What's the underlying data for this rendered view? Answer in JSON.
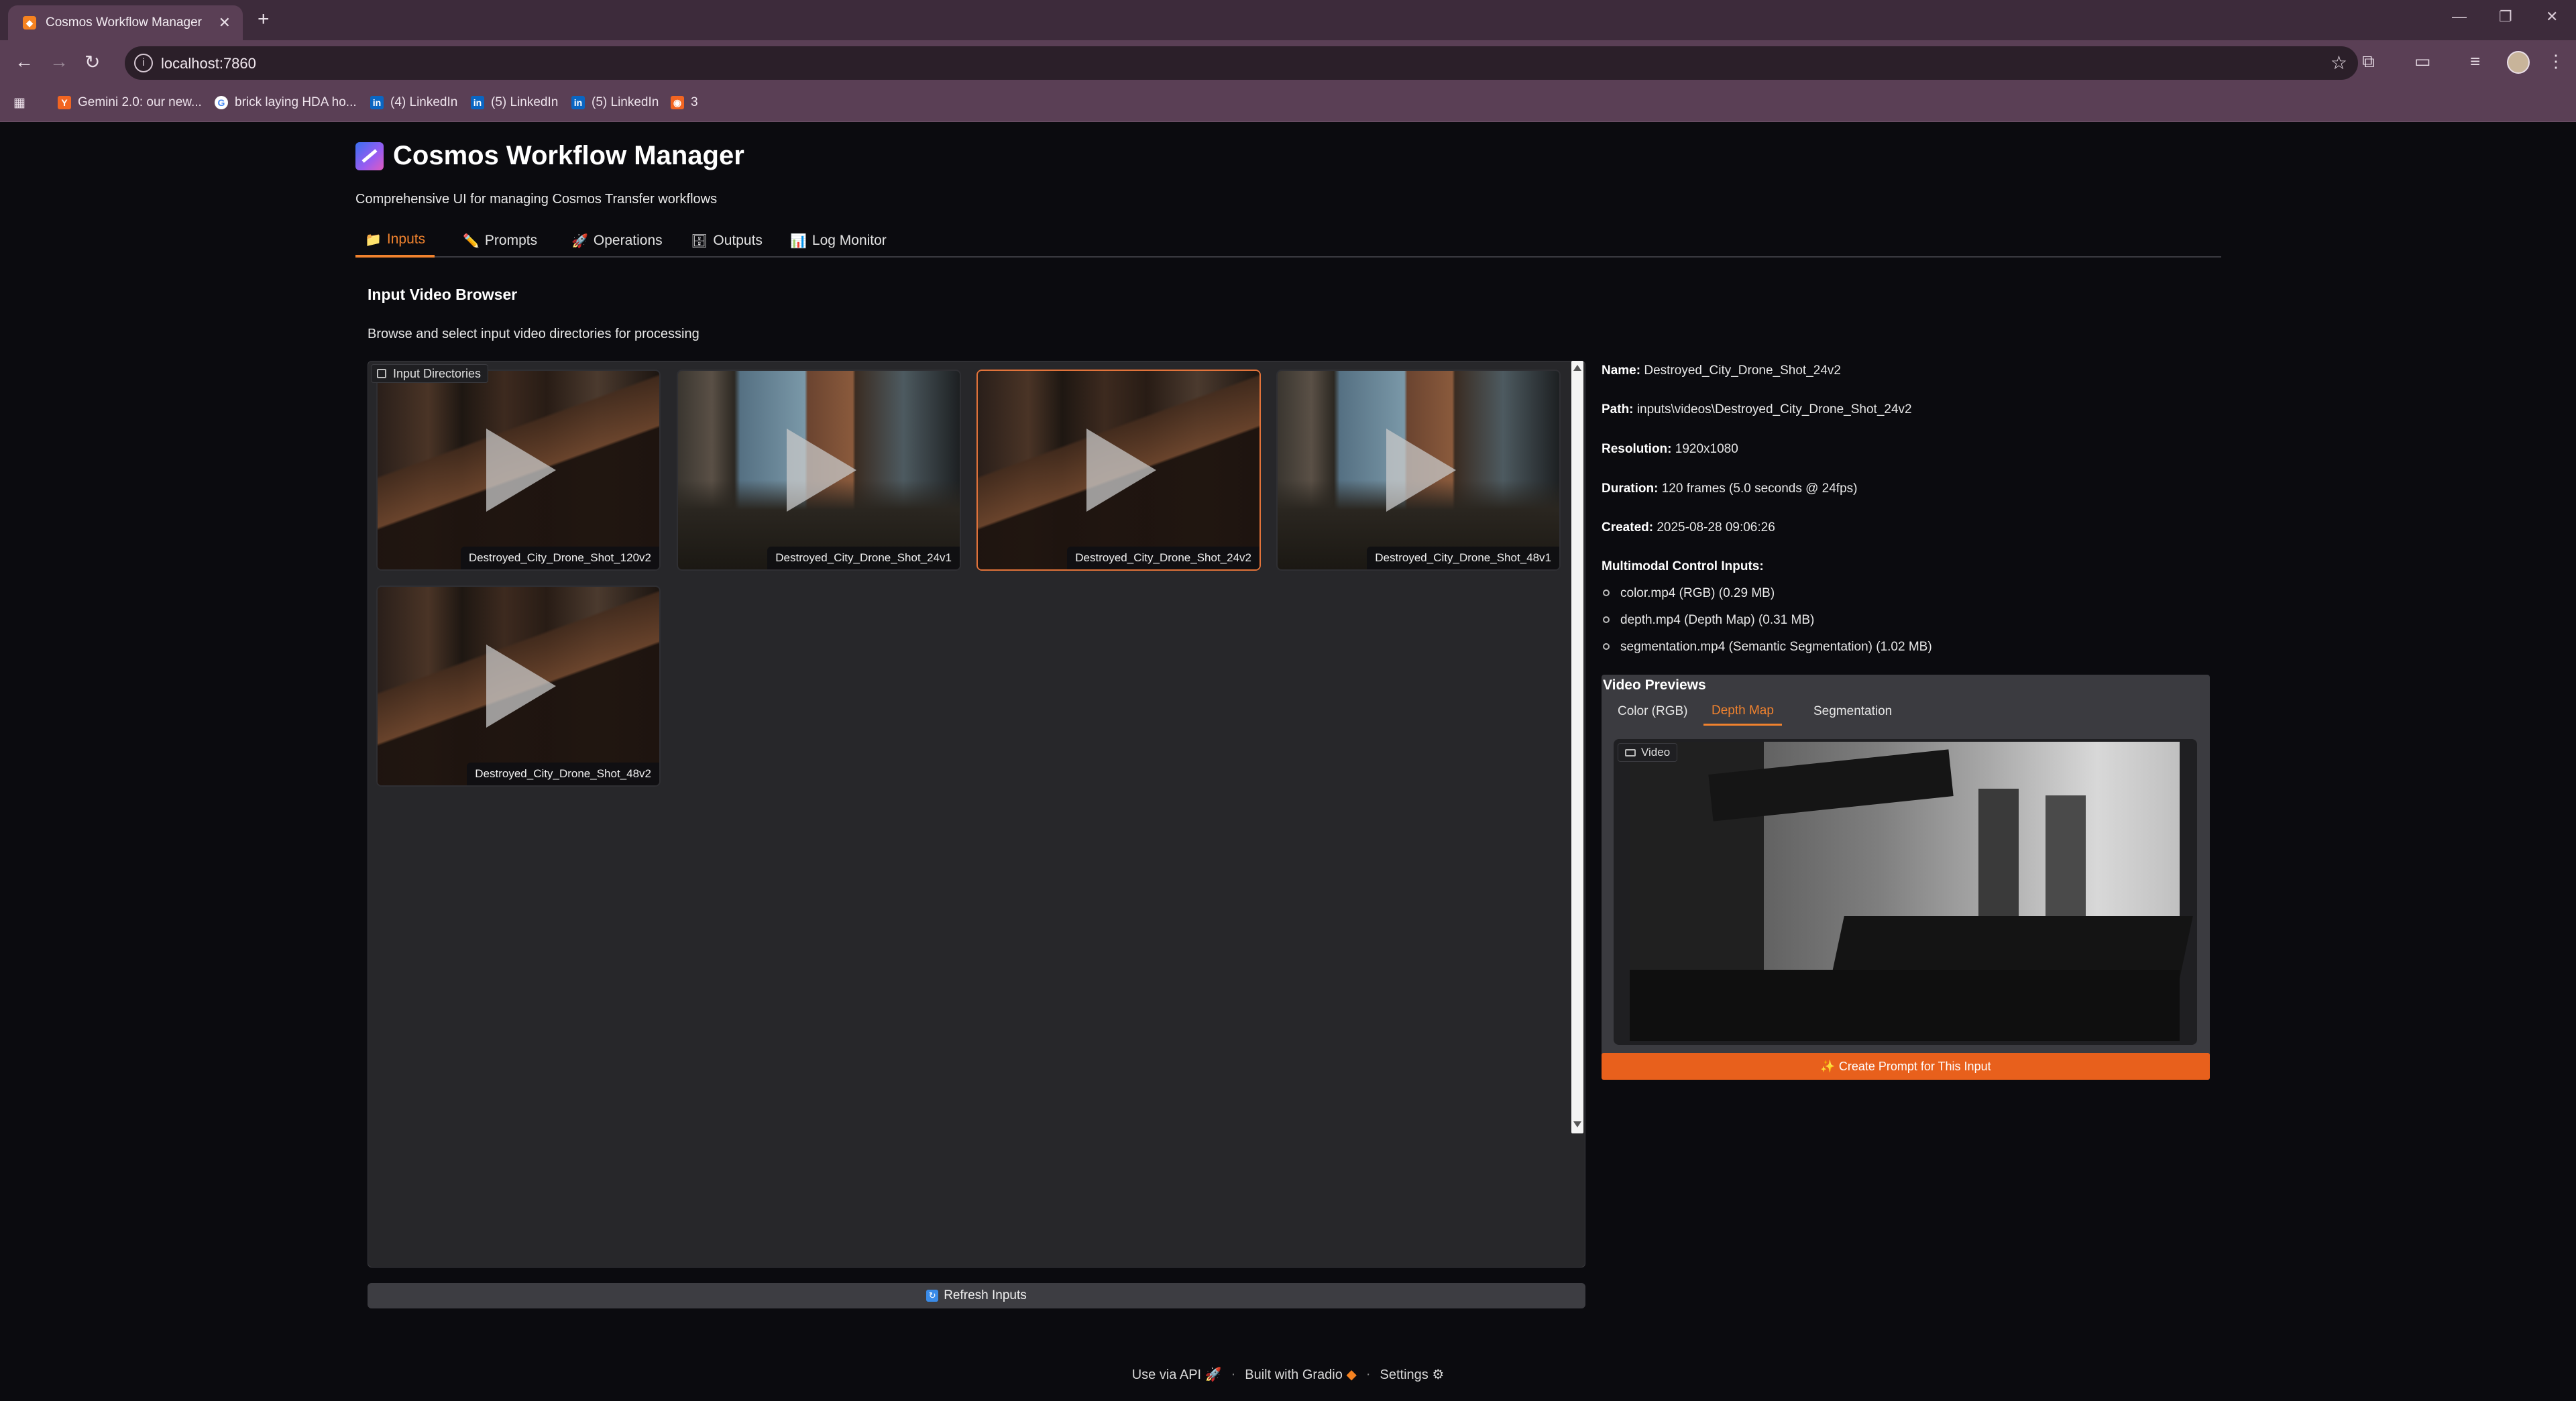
{
  "browser": {
    "tab_title": "Cosmos Workflow Manager",
    "url": "localhost:7860",
    "bookmarks": [
      {
        "label": "Gemini 2.0: our new...",
        "icon": "y-combinator-icon",
        "color": "#f26522"
      },
      {
        "label": "brick laying HDA ho...",
        "icon": "google-icon",
        "color": "#4285f4"
      },
      {
        "label": "(4) LinkedIn",
        "icon": "linkedin-icon",
        "color": "#0a66c2"
      },
      {
        "label": "(5) LinkedIn",
        "icon": "linkedin-icon",
        "color": "#0a66c2"
      },
      {
        "label": "(5) LinkedIn",
        "icon": "linkedin-icon",
        "color": "#0a66c2"
      },
      {
        "label": "3",
        "icon": "rss-icon",
        "color": "#f26522"
      }
    ]
  },
  "app": {
    "title": "Cosmos Workflow Manager",
    "subtitle": "Comprehensive UI for managing Cosmos Transfer workflows",
    "accent": "#f0822e"
  },
  "tabs": [
    {
      "label": "Inputs",
      "icon": "📁",
      "active": true
    },
    {
      "label": "Prompts",
      "icon": "✏️",
      "active": false
    },
    {
      "label": "Operations",
      "icon": "🚀",
      "active": false
    },
    {
      "label": "Outputs",
      "icon": "🗄",
      "active": false
    },
    {
      "label": "Log Monitor",
      "icon": "📊",
      "active": false
    }
  ],
  "browser_section": {
    "title": "Input Video Browser",
    "description": "Browse and select input video directories for processing",
    "gallery_label": "Input Directories",
    "items": [
      {
        "caption": "Destroyed_City_Drone_Shot_120v2",
        "selected": false
      },
      {
        "caption": "Destroyed_City_Drone_Shot_24v1",
        "selected": false
      },
      {
        "caption": "Destroyed_City_Drone_Shot_24v2",
        "selected": true
      },
      {
        "caption": "Destroyed_City_Drone_Shot_48v1",
        "selected": false
      },
      {
        "caption": "Destroyed_City_Drone_Shot_48v2",
        "selected": false
      }
    ],
    "refresh_label": "Refresh Inputs"
  },
  "details": {
    "name_label": "Name:",
    "name": "Destroyed_City_Drone_Shot_24v2",
    "path_label": "Path:",
    "path": "inputs\\videos\\Destroyed_City_Drone_Shot_24v2",
    "resolution_label": "Resolution:",
    "resolution": "1920x1080",
    "duration_label": "Duration:",
    "duration": "120 frames (5.0 seconds @ 24fps)",
    "created_label": "Created:",
    "created": "2025-08-28 09:06:26",
    "multimodal_label": "Multimodal Control Inputs:",
    "multimodal": [
      "color.mp4 (RGB) (0.29 MB)",
      "depth.mp4 (Depth Map) (0.31 MB)",
      "segmentation.mp4 (Semantic Segmentation) (1.02 MB)"
    ]
  },
  "previews": {
    "title": "Video Previews",
    "tabs": [
      {
        "label": "Color (RGB)",
        "active": false
      },
      {
        "label": "Depth Map",
        "active": true
      },
      {
        "label": "Segmentation",
        "active": false
      }
    ],
    "video_label": "Video",
    "create_label": "✨ Create Prompt for This Input"
  },
  "footer": {
    "api": "Use via API",
    "built": "Built with Gradio",
    "settings": "Settings"
  }
}
